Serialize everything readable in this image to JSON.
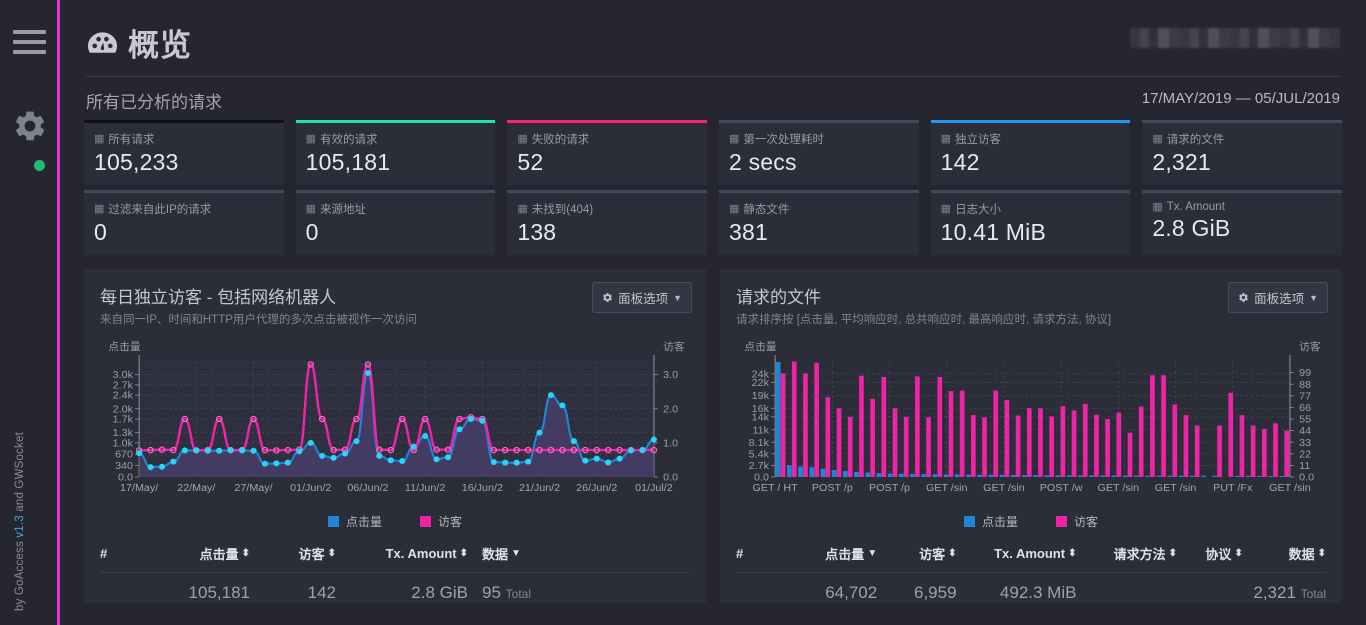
{
  "sidebar": {
    "menu_icon": "hamburger-icon",
    "settings_icon": "gear-icon",
    "status_indicator": "online-dot",
    "credit_prefix": "by GoAccess ",
    "credit_version": "v1.3",
    "credit_suffix": " and GWSocket"
  },
  "header": {
    "title": "概览",
    "title_icon": "dashboard-icon",
    "redacted_block": "redacted-hostname"
  },
  "overview": {
    "label": "所有已分析的请求",
    "date_range": "17/MAY/2019 — 05/JUL/2019"
  },
  "cards": [
    {
      "label": "所有请求",
      "value": "105,233",
      "accent": "#0f1015"
    },
    {
      "label": "有效的请求",
      "value": "105,181",
      "accent": "#1ee8a5"
    },
    {
      "label": "失败的请求",
      "value": "52",
      "accent": "#f5256d"
    },
    {
      "label": "第一次处理耗时",
      "value": "2 secs",
      "accent": "#3c4a63"
    },
    {
      "label": "独立访客",
      "value": "142",
      "accent": "#1d9bf0"
    },
    {
      "label": "请求的文件",
      "value": "2,321",
      "accent": "#3c4a63"
    },
    {
      "label": "过滤来自此IP的请求",
      "value": "0",
      "accent": "#3c4a63"
    },
    {
      "label": "来源地址",
      "value": "0",
      "accent": "#3c4a63"
    },
    {
      "label": "未找到(404)",
      "value": "138",
      "accent": "#3c4a63"
    },
    {
      "label": "静态文件",
      "value": "381",
      "accent": "#3c4a63"
    },
    {
      "label": "日志大小",
      "value": "10.41 MiB",
      "accent": "#3c4a63"
    },
    {
      "label": "Tx. Amount",
      "value": "2.8 GiB",
      "accent": "#3c4a63"
    }
  ],
  "panels": {
    "left": {
      "title": "每日独立访客 - 包括网络机器人",
      "subtitle": "来自同一IP、时间和HTTP用户代理的多次点击被视作一次访问",
      "options_label": "面板选项",
      "options_icon": "gear-icon",
      "table": {
        "columns": [
          "#",
          "点击量",
          "访客",
          "Tx. Amount",
          "数据"
        ],
        "sort_icons": [
          "",
          "updown",
          "updown",
          "updown",
          "down"
        ],
        "row": {
          "index": "",
          "hits": "105,181",
          "visitors": "142",
          "tx": "2.8 GiB",
          "data": "95",
          "data_suffix": "Total"
        }
      }
    },
    "right": {
      "title": "请求的文件",
      "subtitle": "请求排序按 [点击量, 平均响应时, 总共响应时, 最高响应时, 请求方法, 协议]",
      "options_label": "面板选项",
      "options_icon": "gear-icon",
      "table": {
        "columns": [
          "#",
          "点击量",
          "访客",
          "Tx. Amount",
          "请求方法",
          "协议",
          "数据"
        ],
        "sort_icons": [
          "",
          "down",
          "updown",
          "updown",
          "updown",
          "updown",
          "updown"
        ],
        "row": {
          "index": "",
          "hits": "64,702",
          "visitors": "6,959",
          "tx": "492.3 MiB",
          "method": "",
          "protocol": "",
          "data": "2,321",
          "data_suffix": "Total"
        }
      }
    }
  },
  "legend": {
    "hits": "点击量",
    "visitors": "访客",
    "hits_color": "#1d87d6",
    "visitors_color": "#ef23a6"
  },
  "chart_data": [
    {
      "type": "line",
      "id": "daily-unique-visitors",
      "title": "每日独立访客 - 包括网络机器人",
      "xlabel": "",
      "ylabel": "点击量",
      "y2label": "访客",
      "ylim": [
        0,
        3400
      ],
      "y2lim": [
        0,
        3.4
      ],
      "yticks": [
        "0.0",
        "340",
        "670",
        "1.0k",
        "1.3k",
        "1.7k",
        "2.0k",
        "2.4k",
        "2.7k",
        "3.0k"
      ],
      "ytickvals": [
        0,
        340,
        670,
        1000,
        1300,
        1700,
        2000,
        2400,
        2700,
        3000
      ],
      "y2ticks": [
        "0.0",
        "1.0",
        "2.0",
        "3.0"
      ],
      "y2tickvals": [
        0,
        1,
        2,
        3
      ],
      "xticks": [
        "17/May/",
        "22/May/",
        "27/May/",
        "01/Jun/2",
        "06/Jun/2",
        "11/Jun/2",
        "16/Jun/2",
        "21/Jun/2",
        "26/Jun/2",
        "01/Jul/2"
      ],
      "xtick_index": [
        0,
        5,
        10,
        15,
        20,
        25,
        30,
        35,
        40,
        45
      ],
      "grid": true,
      "legend_position": "bottom",
      "series": [
        {
          "name": "点击量",
          "color": "#1d87d6",
          "values": [
            700,
            290,
            300,
            450,
            780,
            780,
            770,
            770,
            780,
            780,
            770,
            390,
            400,
            420,
            750,
            1000,
            620,
            560,
            690,
            1050,
            3050,
            620,
            490,
            470,
            890,
            1200,
            520,
            580,
            1400,
            1700,
            1650,
            440,
            420,
            420,
            450,
            1300,
            2400,
            2100,
            1050,
            480,
            540,
            430,
            540,
            780,
            790,
            1100
          ]
        },
        {
          "name": "访客",
          "color": "#ef23a6",
          "values": [
            780,
            790,
            800,
            790,
            1700,
            780,
            790,
            1700,
            790,
            790,
            1700,
            790,
            780,
            790,
            800,
            3300,
            1700,
            790,
            800,
            1700,
            3300,
            800,
            790,
            1700,
            790,
            1700,
            800,
            800,
            1700,
            1750,
            1700,
            790,
            790,
            790,
            790,
            790,
            790,
            790,
            790,
            790,
            790,
            790,
            790,
            790,
            790,
            790
          ]
        }
      ]
    },
    {
      "type": "bar",
      "id": "requested-files",
      "title": "请求的文件",
      "xlabel": "",
      "ylabel": "点击量",
      "y2label": "访客",
      "ylim": [
        0,
        27000
      ],
      "y2lim": [
        0,
        110
      ],
      "yticks": [
        "0.0",
        "2.7k",
        "5.4k",
        "8.1k",
        "11k",
        "14k",
        "16k",
        "19k",
        "22k",
        "24k"
      ],
      "ytickvals": [
        0,
        2700,
        5400,
        8100,
        11000,
        14000,
        16000,
        19000,
        22000,
        24000
      ],
      "y2ticks": [
        "0.0",
        "11",
        "22",
        "33",
        "44",
        "55",
        "66",
        "77",
        "88",
        "99"
      ],
      "y2tickvals": [
        0,
        11,
        22,
        33,
        44,
        55,
        66,
        77,
        88,
        99
      ],
      "xticks": [
        "GET / HT",
        "POST /p",
        "POST /p",
        "GET /sin",
        "GET /sin",
        "POST /w",
        "GET /sin",
        "GET /sin",
        "PUT /Fx",
        "GET /sin"
      ],
      "xtick_index": [
        0,
        5,
        10,
        15,
        20,
        25,
        30,
        35,
        40,
        45
      ],
      "grid": true,
      "legend_position": "bottom",
      "series": [
        {
          "name": "点击量",
          "color": "#1d87d6",
          "values": [
            26800,
            2750,
            2450,
            2300,
            1950,
            1650,
            1400,
            1200,
            1050,
            900,
            800,
            750,
            700,
            650,
            620,
            600,
            580,
            560,
            540,
            520,
            500,
            480,
            460,
            440,
            420,
            410,
            400,
            390,
            380,
            370,
            360,
            350,
            340,
            330,
            320,
            310,
            300,
            290,
            280,
            270,
            0,
            260,
            250,
            240,
            230,
            220
          ]
        },
        {
          "name": "访客",
          "color": "#ef23a6",
          "values": [
            24100,
            26900,
            24100,
            26600,
            18600,
            16000,
            14000,
            23600,
            18200,
            23300,
            16000,
            14000,
            23400,
            13900,
            23300,
            20000,
            20100,
            14400,
            13900,
            20100,
            17900,
            14300,
            16000,
            16000,
            14100,
            16500,
            15500,
            17000,
            14500,
            13500,
            15000,
            10300,
            16400,
            23700,
            23700,
            16900,
            14400,
            12000,
            0,
            12000,
            19600,
            14400,
            12000,
            11200,
            12500,
            10800
          ]
        }
      ]
    }
  ]
}
